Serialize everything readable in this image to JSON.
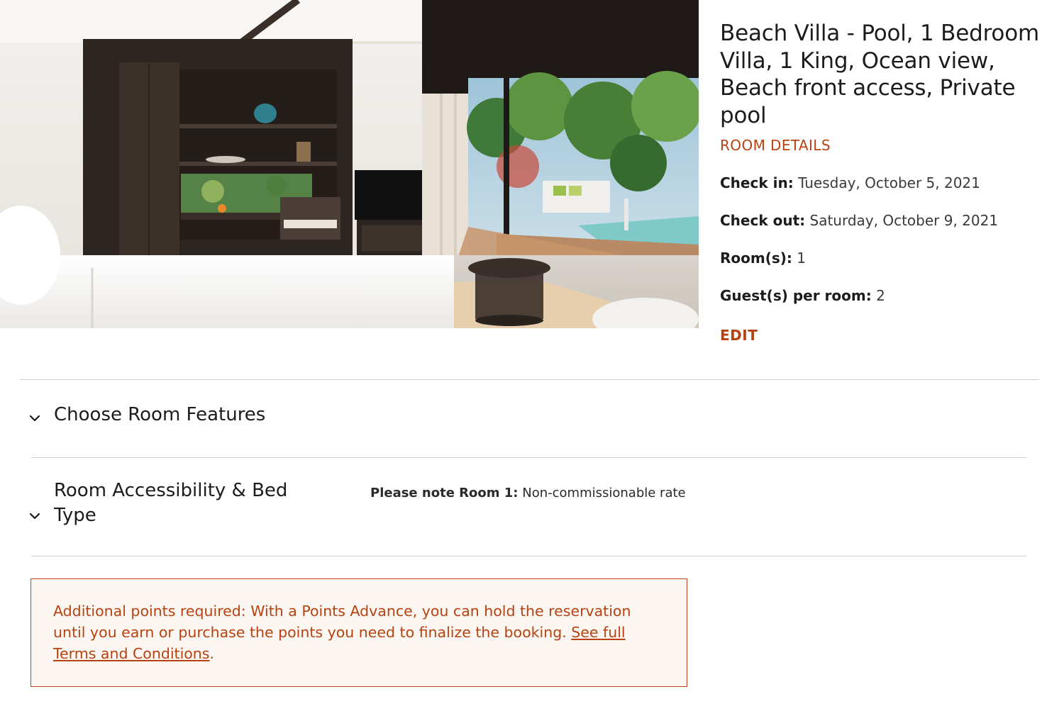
{
  "room": {
    "title": "Beach Villa - Pool, 1 Bedroom Villa, 1 King, Ocean view, Beach front access, Private pool",
    "photo_alt": "Villa bedroom with view of private pool"
  },
  "details": {
    "section_label": "ROOM DETAILS",
    "check_in_label": "Check in:",
    "check_in_value": "Tuesday, October 5, 2021",
    "check_out_label": "Check out:",
    "check_out_value": "Saturday, October 9, 2021",
    "rooms_label": "Room(s):",
    "rooms_value": "1",
    "guests_label": "Guest(s) per room:",
    "guests_value": "2",
    "edit_label": "EDIT"
  },
  "accordion": {
    "features_title": "Choose Room Features",
    "accessibility_title": "Room Accessibility & Bed Type"
  },
  "note": {
    "label": "Please note Room 1:",
    "value": "Non-commissionable rate"
  },
  "notice": {
    "text": "Additional points required: With a Points Advance, you can hold the reservation until you earn or purchase the points you need to finalize the booking.",
    "link_text": "See full Terms and Conditions",
    "trailing": "."
  },
  "icons": {
    "accordion_icon": "chevron-down-icon"
  },
  "colors": {
    "accent": "#b8420f",
    "notice_border": "#c2411d",
    "notice_bg": "#fbf6f1",
    "divider": "#cfcfcf"
  }
}
